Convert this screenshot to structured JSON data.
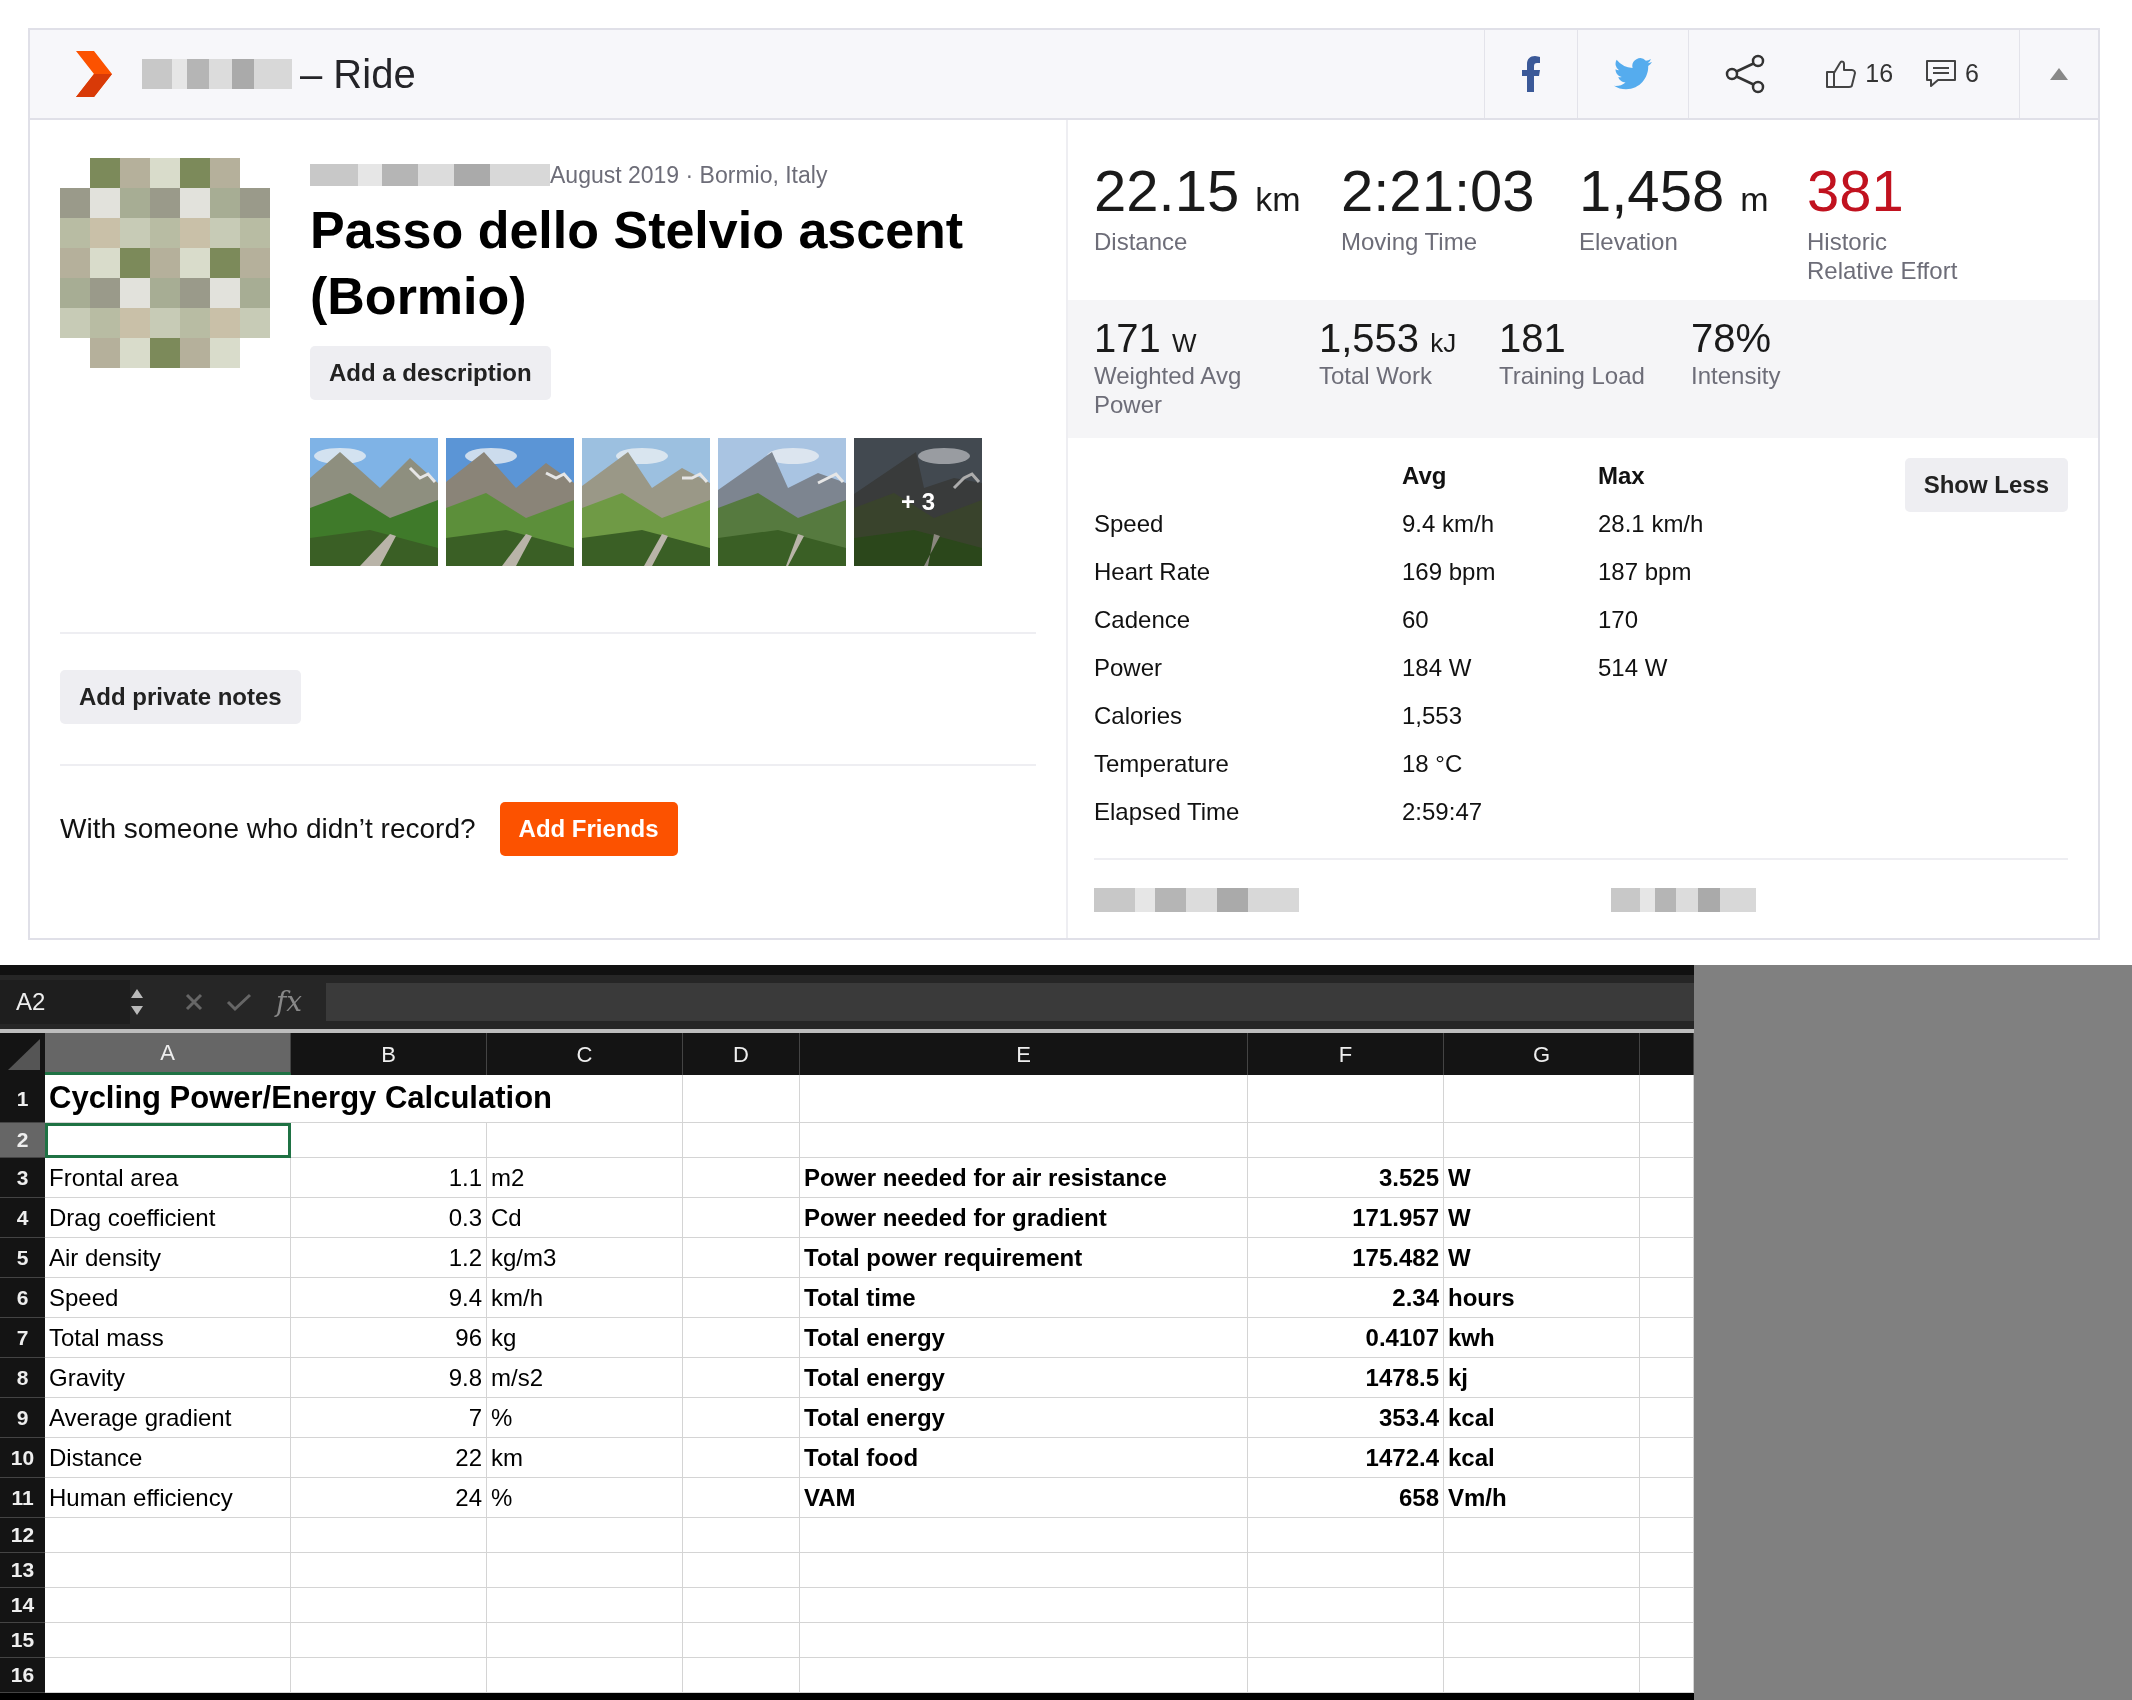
{
  "activity_header": {
    "title": "– Ride",
    "share_buttons": [
      {
        "kind": "facebook"
      },
      {
        "kind": "twitter"
      },
      {
        "kind": "share"
      }
    ],
    "kudos": "16",
    "comments": "6"
  },
  "activity": {
    "meta": "August 2019 · Bormio, Italy",
    "title": "Passo dello Stelvio ascent (Bormio)",
    "description_button": "Add a description",
    "photos": [
      {
        "kind": "picture"
      },
      {
        "kind": "picture"
      },
      {
        "kind": "picture"
      },
      {
        "kind": "picture"
      },
      {
        "kind": "picture",
        "more": "+ 3"
      }
    ],
    "notes_button": "Add private notes",
    "friends_prompt": "With someone who didn’t record?",
    "friends_button": "Add Friends"
  },
  "stats": {
    "primary": [
      {
        "value": "22.15",
        "unit": "km",
        "label": "Distance",
        "highlight": false
      },
      {
        "value": "2:21:03",
        "label": "Moving Time",
        "highlight": false
      },
      {
        "value": "1,458",
        "unit": "m",
        "label": "Elevation",
        "highlight": false
      },
      {
        "value": "381",
        "label": "Historic Relative Effort",
        "highlight": true
      }
    ],
    "secondary": [
      {
        "value": "171",
        "unit": "W",
        "label": "Weighted Avg Power"
      },
      {
        "value": "1,553",
        "unit": "kJ",
        "label": "Total Work"
      },
      {
        "value": "181",
        "label": "Training Load"
      },
      {
        "value": "78%",
        "label": "Intensity"
      }
    ],
    "details": {
      "columns": [
        "Avg",
        "Max"
      ],
      "rows": [
        {
          "label": "Speed",
          "avg": "9.4 km/h",
          "max": "28.1 km/h"
        },
        {
          "label": "Heart Rate",
          "avg": "169 bpm",
          "max": "187 bpm"
        },
        {
          "label": "Cadence",
          "avg": "60",
          "max": "170"
        },
        {
          "label": "Power",
          "avg": "184 W",
          "max": "514 W"
        },
        {
          "label": "Calories",
          "avg": "1,553"
        },
        {
          "label": "Temperature",
          "avg": "18 °C"
        },
        {
          "label": "Elapsed Time",
          "avg": "2:59:47"
        }
      ]
    },
    "toggle_button": "Show Less"
  },
  "spreadsheet": {
    "name_box": "A2",
    "formula_label": "fx",
    "columns": [
      {
        "label": "A",
        "selected": true
      },
      {
        "label": "B",
        "selected": false
      },
      {
        "label": "C",
        "selected": false
      },
      {
        "label": "D",
        "selected": false
      },
      {
        "label": "E",
        "selected": false
      },
      {
        "label": "F",
        "selected": false
      },
      {
        "label": "G",
        "selected": false
      }
    ],
    "rows": [
      {
        "number": "1",
        "selected": false,
        "kind": "title",
        "title": "Cycling Power/Energy Calculation"
      },
      {
        "number": "2",
        "selected": true,
        "kind": "blank"
      },
      {
        "number": "3",
        "selected": false,
        "kind": "data",
        "a": "Frontal area",
        "b": "1.1",
        "c": "m2",
        "e": "Power needed for air resistance",
        "f": "3.525",
        "g": "W"
      },
      {
        "number": "4",
        "selected": false,
        "kind": "data",
        "a": "Drag coefficient",
        "b": "0.3",
        "c": "Cd",
        "e": "Power needed for gradient",
        "f": "171.957",
        "g": "W"
      },
      {
        "number": "5",
        "selected": false,
        "kind": "data",
        "a": "Air density",
        "b": "1.2",
        "c": "kg/m3",
        "e": "Total power requirement",
        "f": "175.482",
        "g": "W"
      },
      {
        "number": "6",
        "selected": false,
        "kind": "data",
        "a": "Speed",
        "b": "9.4",
        "c": "km/h",
        "e": "Total time",
        "f": "2.34",
        "g": "hours"
      },
      {
        "number": "7",
        "selected": false,
        "kind": "data",
        "a": "Total mass",
        "b": "96",
        "c": "kg",
        "e": "Total energy",
        "f": "0.4107",
        "g": "kwh"
      },
      {
        "number": "8",
        "selected": false,
        "kind": "data",
        "a": "Gravity",
        "b": "9.8",
        "c": "m/s2",
        "e": "Total energy",
        "f": "1478.5",
        "g": "kj"
      },
      {
        "number": "9",
        "selected": false,
        "kind": "data",
        "a": "Average gradient",
        "b": "7",
        "c": "%",
        "e": "Total energy",
        "f": "353.4",
        "g": "kcal"
      },
      {
        "number": "10",
        "selected": false,
        "kind": "data",
        "a": "Distance",
        "b": "22",
        "c": "km",
        "e": "Total food",
        "f": "1472.4",
        "g": "kcal"
      },
      {
        "number": "11",
        "selected": false,
        "kind": "data",
        "a": "Human efficiency",
        "b": "24",
        "c": "%",
        "e": "VAM",
        "f": "658",
        "g": "Vm/h"
      },
      {
        "number": "12",
        "selected": false,
        "kind": "blank"
      },
      {
        "number": "13",
        "selected": false,
        "kind": "blank"
      },
      {
        "number": "14",
        "selected": false,
        "kind": "blank"
      },
      {
        "number": "15",
        "selected": false,
        "kind": "blank"
      },
      {
        "number": "16",
        "selected": false,
        "kind": "blank"
      }
    ]
  }
}
